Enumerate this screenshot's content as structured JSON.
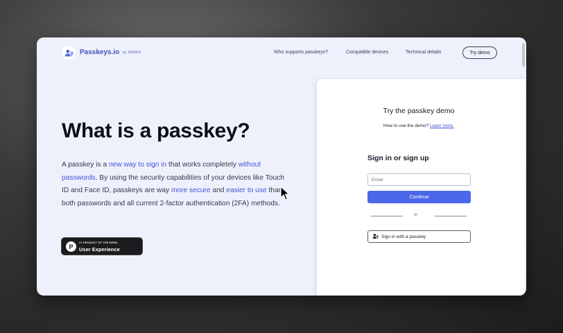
{
  "nav": {
    "brand": "Passkeys.io",
    "brand_sub": "by HANKO",
    "links": [
      "Who supports passkeys?",
      "Compatible devices",
      "Technical details"
    ],
    "cta": "Try demo"
  },
  "hero": {
    "title": "What is a passkey?",
    "body": {
      "t1": "A passkey is a ",
      "l1": "new way to sign in",
      "t2": " that works completely ",
      "l2": "without passwords",
      "t3": ". By using the security capabilities of your devices like Touch ID and Face ID, passkeys are way ",
      "l3": "more secure",
      "t4": " and ",
      "l4": "easier to use",
      "t5": " than both passwords and all current 2-factor authentication (2FA) methods."
    },
    "badge": {
      "small": "#1 PRODUCT OF THE WEEK",
      "main": "User Experience",
      "letter": "P"
    }
  },
  "demo_panel": {
    "title": "Try the passkey demo",
    "subtitle": "How to use the demo?",
    "subtitle_link": "Learn more.",
    "signin_heading": "Sign in or sign up",
    "email_placeholder": "Email",
    "continue_label": "Continue",
    "divider_text": "or",
    "passkey_button_label": "Sign in with a passkey"
  },
  "icons": {
    "logo": "user-key-icon",
    "passkey": "user-key-icon",
    "cursor": "mouse-pointer-icon",
    "badge": "product-hunt-icon"
  },
  "colors": {
    "accent": "#4b68ea",
    "link": "#3f55d6",
    "page_bg": "#eef1fc"
  }
}
